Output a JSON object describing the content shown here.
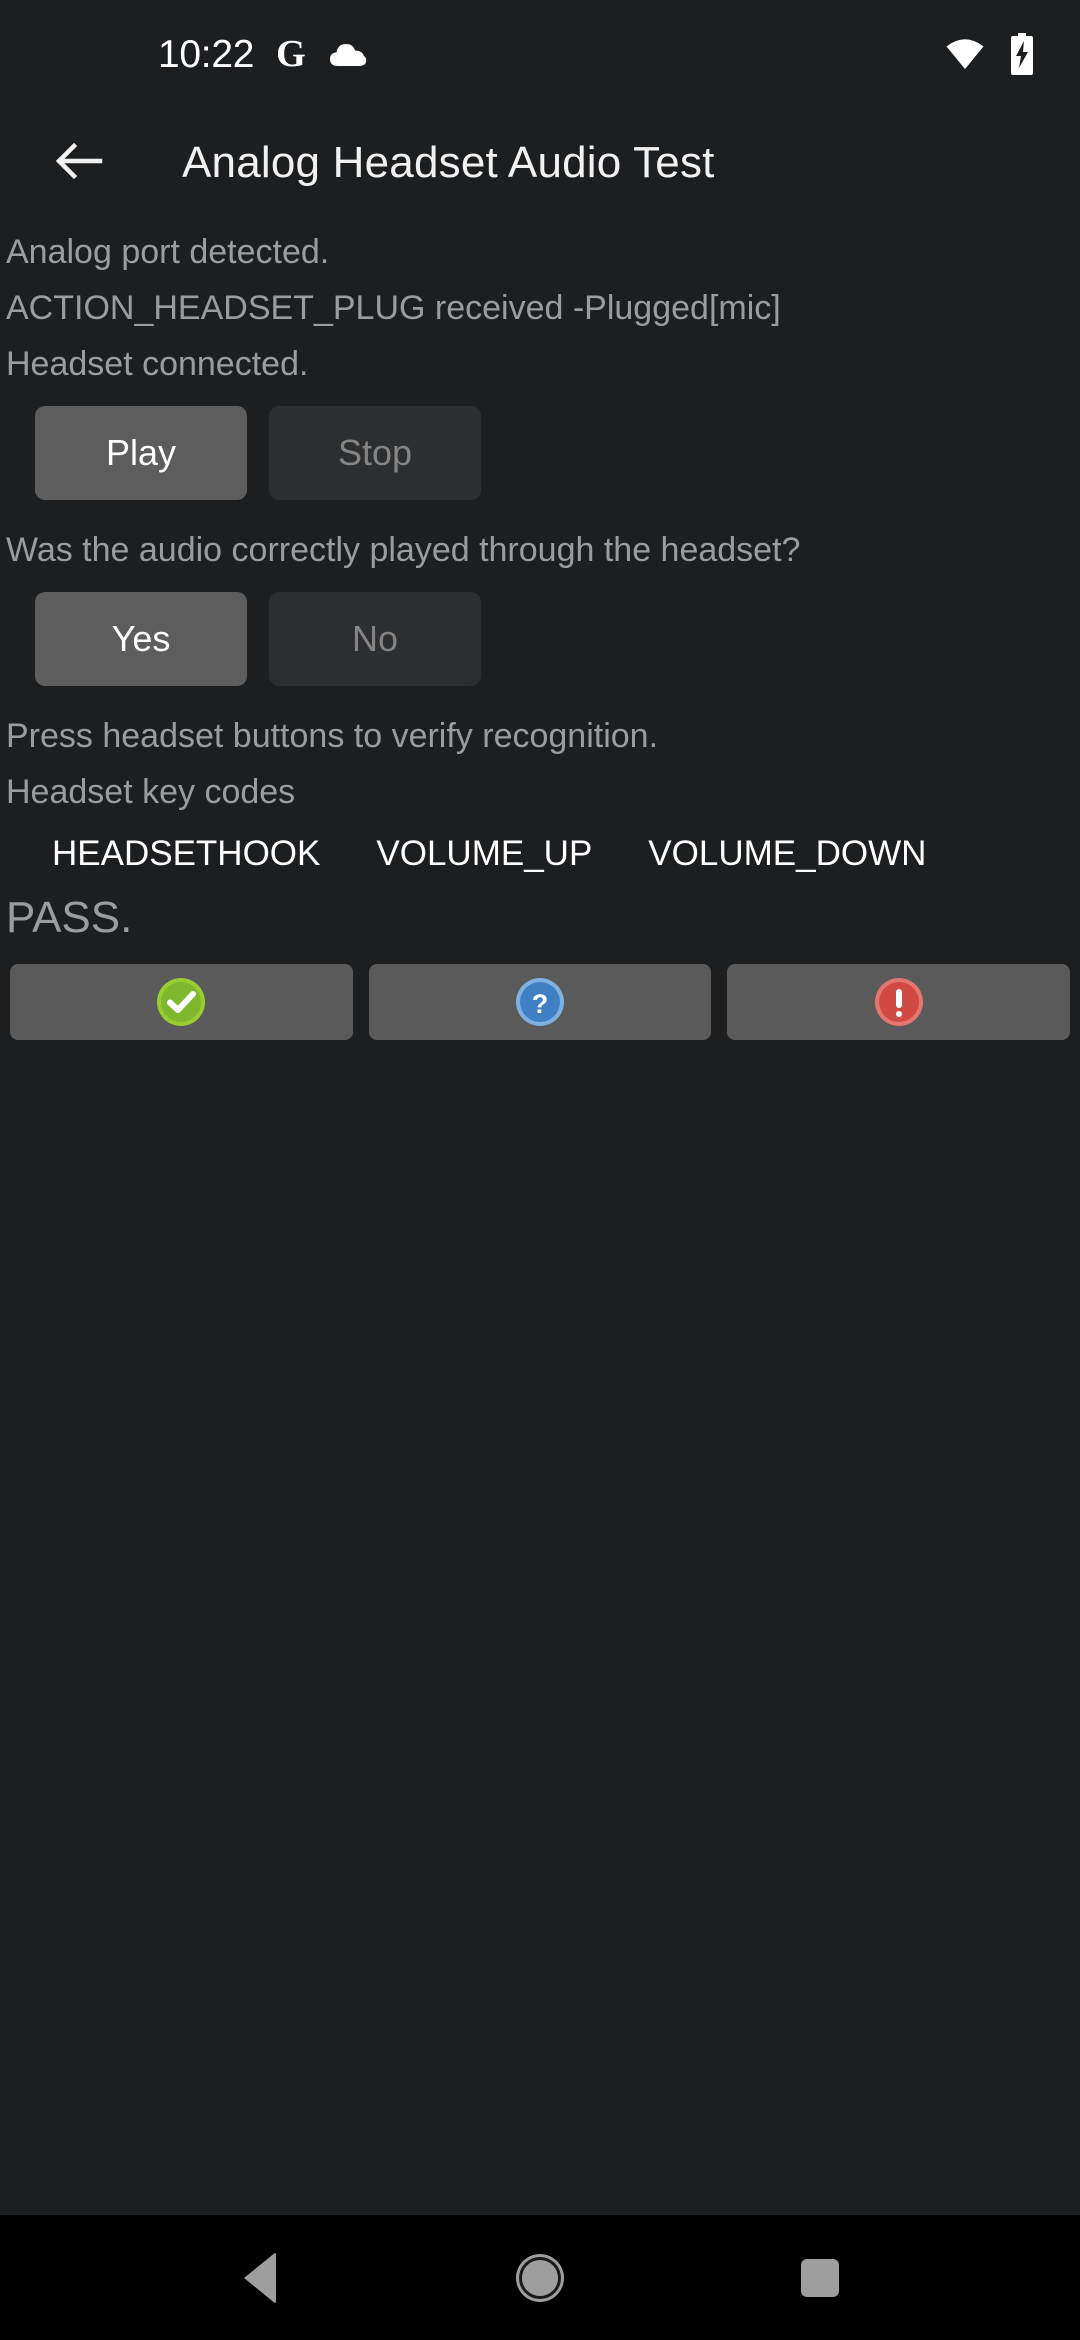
{
  "status_bar": {
    "time": "10:22",
    "google_glyph": "G",
    "icons": [
      "google-icon",
      "cloud-icon",
      "wifi-icon",
      "battery-charging-icon"
    ]
  },
  "app_bar": {
    "back_label": "back-arrow",
    "title": "Analog Headset Audio Test"
  },
  "main": {
    "status_lines": [
      "Analog port detected.",
      "ACTION_HEADSET_PLUG received -Plugged[mic]",
      "Headset connected."
    ],
    "playback": {
      "play_label": "Play",
      "stop_label": "Stop"
    },
    "question": "Was the audio correctly played through the headset?",
    "answer": {
      "yes_label": "Yes",
      "no_label": "No"
    },
    "press_hint": "Press headset buttons to verify recognition.",
    "keycodes_title": "Headset key codes",
    "keycodes": [
      "HEADSETHOOK",
      "VOLUME_UP",
      "VOLUME_DOWN"
    ],
    "verdict": "PASS."
  },
  "action_bar": {
    "buttons": [
      {
        "name": "pass-button",
        "icon": "check-circle-icon",
        "color": "#8cc63f"
      },
      {
        "name": "info-button",
        "icon": "question-circle-icon",
        "color": "#4a90d9"
      },
      {
        "name": "fail-button",
        "icon": "exclamation-circle-icon",
        "color": "#d9534f"
      }
    ]
  },
  "nav_bar": {
    "back": "nav-back-icon",
    "home": "nav-home-icon",
    "recents": "nav-recents-icon"
  },
  "colors": {
    "background": "#1d1e20",
    "nav_background": "#000000",
    "button_enabled": "#5d5d5d",
    "button_disabled": "#2d2e30",
    "text_primary": "#ffffff",
    "text_secondary": "#9a9c9f",
    "action_button": "#5a5a5a",
    "pass_green": "#8cc63f",
    "info_blue": "#4a90d9",
    "fail_red": "#d9534f"
  }
}
